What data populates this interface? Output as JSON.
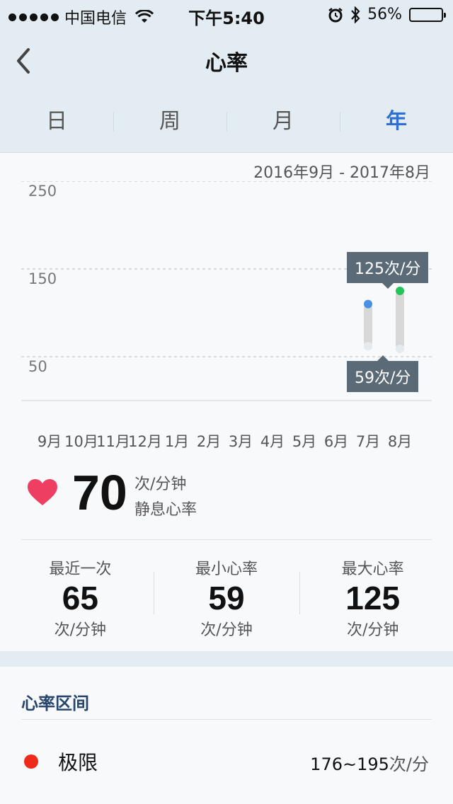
{
  "status_bar": {
    "carrier": "中国电信",
    "time": "下午5:40",
    "battery": "56%",
    "battery_level": 0.56
  },
  "nav": {
    "title": "心率",
    "back_icon": "chevron-left-icon"
  },
  "tabs": [
    {
      "label": "日",
      "active": false
    },
    {
      "label": "周",
      "active": false
    },
    {
      "label": "月",
      "active": false
    },
    {
      "label": "年",
      "active": true
    }
  ],
  "date_range": "2016年9月 - 2017年8月",
  "chart_data": {
    "type": "bar",
    "categories": [
      "9月",
      "10月",
      "11月",
      "12月",
      "1月",
      "2月",
      "3月",
      "4月",
      "5月",
      "6月",
      "7月",
      "8月"
    ],
    "y_ticks": [
      "250",
      "150",
      "50"
    ],
    "ylim": [
      50,
      250
    ],
    "series": [
      {
        "low": null,
        "high": null
      },
      {
        "low": null,
        "high": null
      },
      {
        "low": null,
        "high": null
      },
      {
        "low": null,
        "high": null
      },
      {
        "low": null,
        "high": null
      },
      {
        "low": null,
        "high": null
      },
      {
        "low": null,
        "high": null
      },
      {
        "low": null,
        "high": null
      },
      {
        "low": null,
        "high": null
      },
      {
        "low": null,
        "high": null
      },
      {
        "low": 62,
        "high": 110
      },
      {
        "low": 59,
        "high": 125
      }
    ],
    "tooltip_high": "125次/分",
    "tooltip_low": "59次/分",
    "colors": {
      "range_bar": "#d8d8d8",
      "high_dot_selected": "#25c45a",
      "high_dot": "#4a90e2",
      "grid": "#b5bec4"
    }
  },
  "resting": {
    "value": "70",
    "unit": "次/分钟",
    "label": "静息心率",
    "heart_color": "#ee3f63"
  },
  "stats": [
    {
      "label": "最近一次",
      "value": "65",
      "unit": "次/分钟"
    },
    {
      "label": "最小心率",
      "value": "59",
      "unit": "次/分钟"
    },
    {
      "label": "最大心率",
      "value": "125",
      "unit": "次/分钟"
    }
  ],
  "zones": {
    "heading": "心率区间",
    "items": [
      {
        "name": "极限",
        "range": "176~195",
        "unit": "次/分",
        "color": "#ee2a1b"
      }
    ]
  }
}
